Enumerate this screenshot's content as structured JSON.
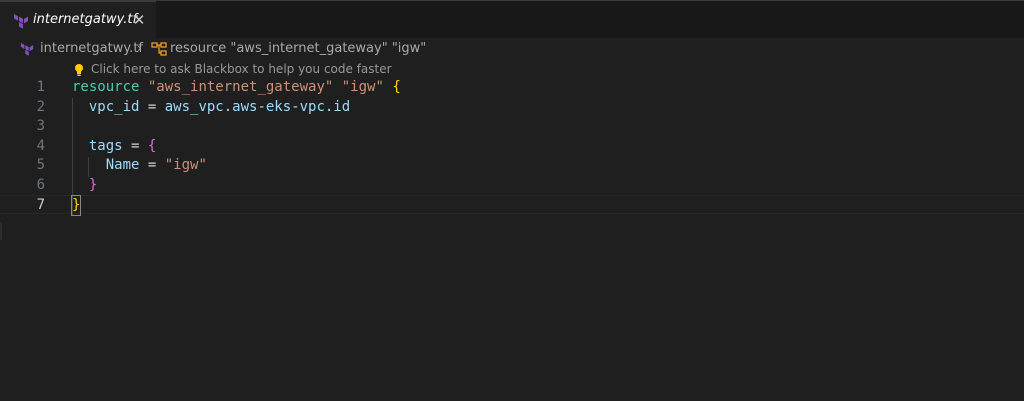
{
  "tab": {
    "title": "internetgatwy.tf",
    "close": "✕"
  },
  "breadcrumb": {
    "file": "internetgatwy.tf",
    "separator": "›",
    "symbol": "resource \"aws_internet_gateway\" \"igw\""
  },
  "codelens": {
    "text": "Click here to ask Blackbox to help you code faster"
  },
  "lines": [
    {
      "n": "1",
      "tokens": [
        [
          "kw",
          "resource"
        ],
        [
          "op",
          " "
        ],
        [
          "str",
          "\"aws_internet_gateway\""
        ],
        [
          "op",
          " "
        ],
        [
          "str",
          "\"igw\""
        ],
        [
          "op",
          " "
        ],
        [
          "br1",
          "{"
        ]
      ]
    },
    {
      "n": "2",
      "tokens": [
        [
          "op",
          "  "
        ],
        [
          "id",
          "vpc_id"
        ],
        [
          "op",
          " = "
        ],
        [
          "id",
          "aws_vpc.aws-eks-vpc.id"
        ]
      ]
    },
    {
      "n": "3",
      "tokens": []
    },
    {
      "n": "4",
      "tokens": [
        [
          "op",
          "  "
        ],
        [
          "id",
          "tags"
        ],
        [
          "op",
          " = "
        ],
        [
          "br2",
          "{"
        ]
      ]
    },
    {
      "n": "5",
      "tokens": [
        [
          "op",
          "    "
        ],
        [
          "id",
          "Name"
        ],
        [
          "op",
          " = "
        ],
        [
          "str",
          "\"igw\""
        ]
      ]
    },
    {
      "n": "6",
      "tokens": [
        [
          "op",
          "  "
        ],
        [
          "br2",
          "}"
        ]
      ]
    },
    {
      "n": "7",
      "tokens": [
        [
          "br1match",
          "}"
        ]
      ]
    }
  ],
  "active_line": "7",
  "colors": {
    "keyword": "#4ec9b0",
    "string": "#ce9178",
    "identifier": "#9cdcfe",
    "bracket1": "#ffd700",
    "bracket2": "#da70d6",
    "terraform": "#844fba"
  },
  "icons": {
    "tab": "terraform-icon",
    "breadcrumb_file": "terraform-icon",
    "breadcrumb_symbol": "symbol-structure-icon",
    "codelens": "lightbulb-icon"
  }
}
